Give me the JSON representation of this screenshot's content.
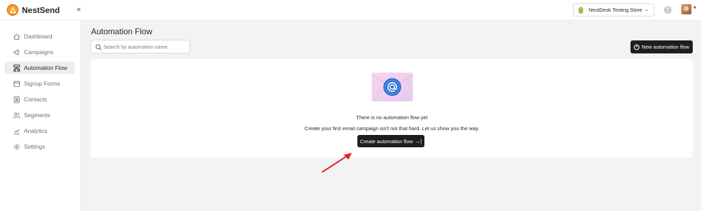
{
  "app": {
    "name": "NestSend",
    "collapse_icon": "double-chevron-left-icon"
  },
  "header": {
    "store_name": "NestDesk Testing Store",
    "store_icon": "shopify-bag-icon",
    "help_label": "?",
    "avatar": "user-avatar"
  },
  "sidebar": {
    "items": [
      {
        "label": "Dashboard",
        "icon": "home-icon",
        "active": false
      },
      {
        "label": "Campaigns",
        "icon": "megaphone-icon",
        "active": false
      },
      {
        "label": "Automation Flow",
        "icon": "flow-icon",
        "active": true
      },
      {
        "label": "Signup Forms",
        "icon": "form-icon",
        "active": false
      },
      {
        "label": "Contacts",
        "icon": "contacts-icon",
        "active": false
      },
      {
        "label": "Segments",
        "icon": "segments-icon",
        "active": false
      },
      {
        "label": "Analytics",
        "icon": "analytics-icon",
        "active": false
      },
      {
        "label": "Settings",
        "icon": "gear-icon",
        "active": false
      }
    ]
  },
  "main": {
    "title": "Automation Flow",
    "search_placeholder": "Search by automation name",
    "new_button": "New automation flow",
    "empty_state": {
      "title": "There is no automation flow yet",
      "subtitle": "Create your first email campaign isn't not that hard. Let us show you the way.",
      "button": "Create automation flow"
    }
  },
  "colors": {
    "brand": "#f59e2c",
    "primary_button": "#1d1e22",
    "active_nav": "#ededef",
    "annotation_arrow": "#e02424",
    "envelope_accent": "#2f6fd6"
  }
}
